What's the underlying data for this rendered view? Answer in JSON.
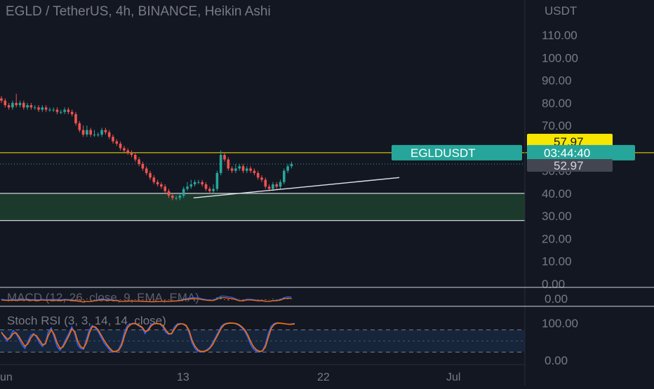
{
  "header": {
    "title": "EGLD / TetherUS, 4h, BINANCE, Heikin Ashi"
  },
  "price_axis": {
    "currency": "USDT",
    "ticks": [
      "110.00",
      "100.00",
      "90.00",
      "80.00",
      "70.00",
      "60.00",
      "50.00",
      "40.00",
      "30.00",
      "20.00",
      "10.00",
      "0.00"
    ]
  },
  "labels": {
    "level_price": "57.97",
    "symbol": "EGLDUSDT",
    "countdown": "03:44:40",
    "last_price": "52.97"
  },
  "macd": {
    "title": "MACD (12, 26, close, 9, EMA, EMA)",
    "value": "0.00"
  },
  "stoch": {
    "title": "Stoch RSI (3, 3, 14, 14, close)",
    "ticks": [
      "100.00",
      "0.00"
    ]
  },
  "time_axis": {
    "ticks": [
      "Jun",
      "13",
      "22",
      "Jul"
    ]
  },
  "colors": {
    "background": "#131722",
    "up_candle": "#26a69a",
    "down_candle": "#ef5350",
    "level_line": "#f7e600",
    "support_zone": "#1c3a2c",
    "stoch_k": "#2962ff",
    "stoch_d": "#ff6d00",
    "symbol_badge": "#26a69a"
  },
  "chart_data": {
    "type": "candlestick",
    "x": [
      1,
      2,
      3,
      4,
      5,
      6,
      7,
      8,
      9,
      10,
      11,
      12,
      13,
      14,
      15,
      16,
      17,
      18,
      19,
      20,
      21,
      22,
      23,
      24,
      25,
      26,
      27,
      28,
      29,
      30,
      31,
      32,
      33,
      34,
      35,
      36,
      37,
      38,
      39,
      40,
      41,
      42,
      43,
      44,
      45,
      46,
      47,
      48,
      49,
      50,
      51,
      52,
      53,
      54,
      55,
      56,
      57,
      58,
      59,
      60,
      61,
      62,
      63,
      64,
      65,
      66,
      67,
      68,
      69,
      70,
      71,
      72,
      73,
      74,
      75,
      76,
      77,
      78,
      79,
      80,
      81,
      82,
      83,
      84,
      85,
      86,
      87,
      88,
      89,
      90,
      91,
      92,
      93,
      94,
      95,
      96,
      97,
      98,
      99,
      100,
      101
    ],
    "open": [
      82,
      81,
      79,
      78,
      80,
      79,
      80,
      78,
      79,
      78,
      78,
      77,
      78,
      77,
      77,
      77,
      76,
      76,
      77,
      76,
      75,
      71,
      68,
      66,
      68,
      66,
      66,
      66,
      68,
      67,
      65,
      63,
      62,
      60,
      59,
      58,
      57,
      55,
      53,
      51,
      49,
      47,
      45,
      44,
      43,
      41,
      39,
      38,
      38,
      39,
      42,
      43,
      44,
      45,
      45,
      44,
      42,
      41,
      42,
      49,
      57,
      55,
      51,
      50,
      51,
      52,
      50,
      51,
      50,
      49,
      47,
      46,
      43,
      42,
      44,
      43,
      45,
      50,
      52
    ],
    "close": [
      81,
      79,
      78,
      80,
      79,
      80,
      78,
      79,
      78,
      78,
      77,
      78,
      77,
      77,
      77,
      76,
      76,
      77,
      76,
      75,
      71,
      68,
      66,
      68,
      66,
      66,
      66,
      68,
      67,
      65,
      63,
      62,
      60,
      59,
      58,
      57,
      55,
      53,
      51,
      49,
      47,
      45,
      44,
      43,
      41,
      39,
      38,
      38,
      39,
      42,
      43,
      44,
      45,
      45,
      44,
      42,
      41,
      42,
      49,
      57,
      55,
      51,
      50,
      51,
      52,
      50,
      51,
      50,
      49,
      47,
      46,
      43,
      42,
      44,
      43,
      45,
      50,
      52,
      53
    ],
    "high": [
      83,
      82,
      80,
      81,
      84,
      81,
      81,
      80,
      80,
      79,
      79,
      79,
      79,
      78,
      78,
      78,
      77,
      78,
      78,
      77,
      76,
      72,
      70,
      70,
      69,
      68,
      67,
      69,
      69,
      68,
      66,
      64,
      63,
      61,
      60,
      59,
      58,
      56,
      54,
      52,
      50,
      48,
      46,
      45,
      44,
      42,
      40,
      39,
      40,
      43,
      45,
      46,
      46,
      46,
      46,
      45,
      43,
      44,
      50,
      59,
      58,
      56,
      52,
      53,
      53,
      53,
      52,
      52,
      51,
      50,
      48,
      47,
      44,
      45,
      45,
      46,
      51,
      53,
      54
    ],
    "low": [
      80,
      78,
      77,
      77,
      78,
      78,
      77,
      77,
      77,
      77,
      76,
      76,
      76,
      76,
      76,
      75,
      75,
      75,
      75,
      74,
      70,
      67,
      65,
      65,
      65,
      65,
      65,
      65,
      66,
      64,
      62,
      61,
      59,
      58,
      57,
      56,
      54,
      52,
      50,
      48,
      46,
      44,
      43,
      42,
      40,
      38,
      37,
      37,
      37,
      38,
      41,
      42,
      43,
      44,
      43,
      41,
      40,
      40,
      41,
      48,
      54,
      50,
      49,
      49,
      50,
      49,
      49,
      49,
      48,
      46,
      45,
      42,
      41,
      41,
      42,
      42,
      44,
      49,
      51
    ],
    "ylim": [
      0,
      117
    ],
    "horizontal_lines": [
      57.97,
      40,
      28
    ],
    "support_zone": [
      28,
      40
    ],
    "trendline": [
      {
        "x": 47,
        "y": 38
      },
      {
        "x": 108,
        "y": 47
      }
    ],
    "stoch_k": [
      75,
      60,
      50,
      62,
      78,
      70,
      55,
      40,
      30,
      48,
      65,
      70,
      60,
      45,
      35,
      45,
      75,
      85,
      60,
      35,
      25,
      38,
      55,
      70,
      88,
      70,
      40,
      30,
      28,
      55,
      80,
      92,
      85,
      75,
      60,
      45,
      35,
      25,
      20,
      22,
      28,
      45,
      75,
      92,
      96,
      98,
      95,
      90,
      85,
      70,
      82,
      94,
      98,
      97,
      96,
      88,
      74,
      68,
      70,
      88,
      96,
      97,
      95,
      90,
      72,
      45,
      30,
      22,
      20,
      22,
      26,
      32,
      45,
      60,
      75,
      90,
      96,
      98,
      99,
      98,
      96,
      92,
      85,
      76,
      60,
      40,
      28,
      22,
      20,
      24,
      40,
      70,
      90,
      97,
      99,
      98,
      97,
      96,
      95,
      96,
      97
    ],
    "stoch_d": [
      72,
      64,
      55,
      58,
      70,
      72,
      62,
      48,
      36,
      42,
      58,
      68,
      64,
      52,
      40,
      42,
      65,
      80,
      68,
      45,
      30,
      34,
      48,
      64,
      82,
      76,
      50,
      35,
      30,
      45,
      72,
      88,
      88,
      80,
      66,
      52,
      40,
      30,
      22,
      22,
      25,
      38,
      65,
      86,
      94,
      97,
      96,
      92,
      87,
      76,
      78,
      90,
      96,
      97,
      96,
      92,
      80,
      70,
      69,
      82,
      93,
      96,
      96,
      92,
      78,
      52,
      36,
      26,
      22,
      22,
      24,
      30,
      40,
      55,
      70,
      85,
      94,
      97,
      98,
      98,
      97,
      94,
      88,
      80,
      66,
      48,
      34,
      26,
      22,
      23,
      34,
      60,
      84,
      94,
      98,
      98,
      97,
      96,
      95,
      95,
      96
    ]
  }
}
